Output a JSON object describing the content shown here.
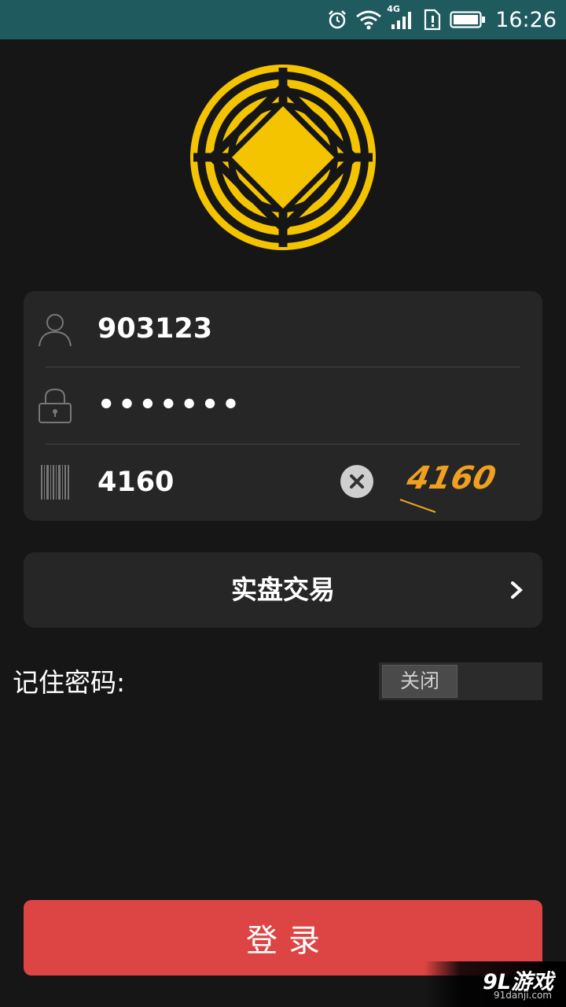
{
  "status_bar": {
    "network": "4G",
    "time": "16:26"
  },
  "login_form": {
    "username_value": "903123",
    "password_value": "•••••••",
    "captcha_value": "4160",
    "captcha_image_text": "4160"
  },
  "trade_mode": {
    "label": "实盘交易"
  },
  "remember_password": {
    "label": "记住密码:",
    "toggle_state": "关闭"
  },
  "login_button": {
    "label": "登录"
  },
  "watermark": {
    "brand": "9L游戏",
    "url": "91danji.com"
  },
  "colors": {
    "background": "#161616",
    "status_bar": "#1f5a5e",
    "panel": "#262626",
    "logo_gold": "#f5c400",
    "login_button": "#dd4444",
    "captcha_orange": "#f0a020"
  },
  "icons": [
    "alarm-icon",
    "wifi-icon",
    "signal-icon",
    "sim-alert-icon",
    "battery-icon",
    "user-icon",
    "lock-icon",
    "barcode-icon",
    "clear-icon",
    "chevron-right-icon"
  ]
}
